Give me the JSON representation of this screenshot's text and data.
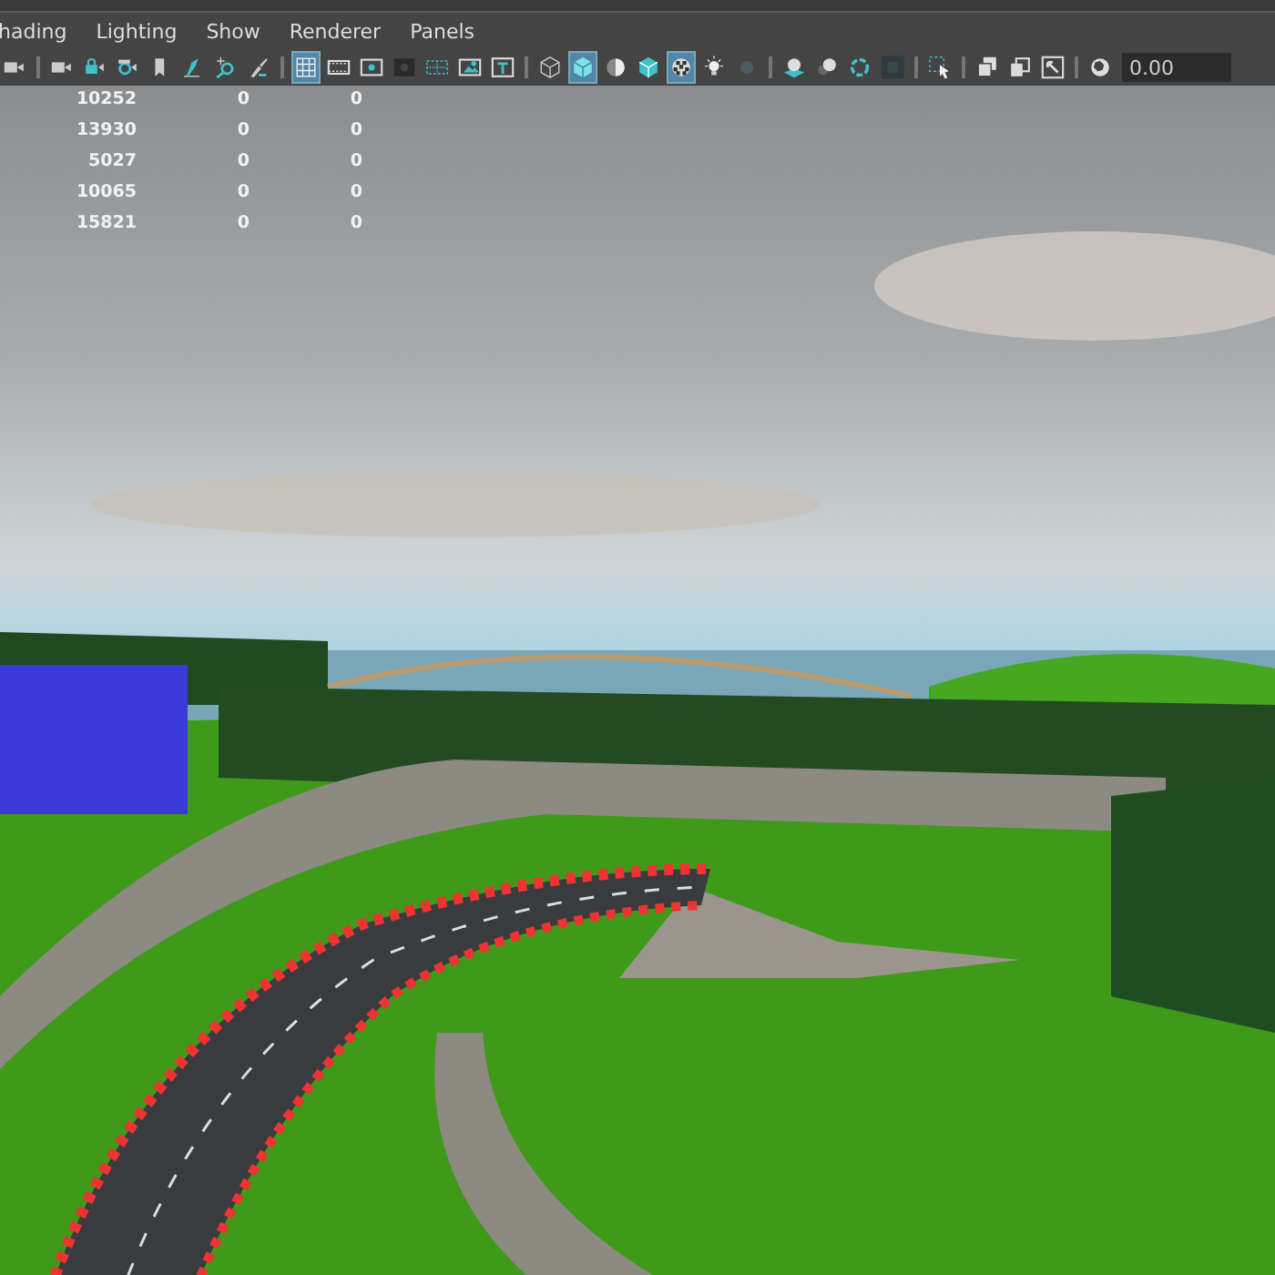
{
  "menu_bar": {
    "items": [
      "hading",
      "Lighting",
      "Show",
      "Renderer",
      "Panels"
    ]
  },
  "toolbar": {
    "groups": [
      {
        "buttons": [
          {
            "selected": false
          }
        ]
      },
      {
        "buttons": [
          {
            "selected": false
          },
          {
            "selected": false
          },
          {
            "selected": false
          },
          {
            "selected": false
          },
          {
            "selected": false
          },
          {
            "selected": false
          },
          {
            "selected": false
          }
        ]
      },
      {
        "buttons": [
          {
            "selected": true
          },
          {
            "selected": false
          },
          {
            "selected": false
          },
          {
            "selected": false
          },
          {
            "selected": false
          },
          {
            "selected": false
          },
          {
            "selected": false
          }
        ]
      },
      {
        "buttons": [
          {
            "selected": false
          },
          {
            "selected": true
          },
          {
            "selected": false
          },
          {
            "selected": false
          },
          {
            "selected": true
          },
          {
            "selected": false
          },
          {
            "selected": false
          }
        ]
      },
      {
        "buttons": [
          {
            "selected": false
          },
          {
            "selected": false
          },
          {
            "selected": false
          },
          {
            "selected": false
          }
        ]
      },
      {
        "buttons": [
          {
            "selected": false
          }
        ]
      },
      {
        "buttons": [
          {
            "selected": false
          },
          {
            "selected": false
          },
          {
            "selected": false
          }
        ]
      },
      {
        "buttons": [
          {
            "selected": false
          }
        ]
      }
    ],
    "time_field": {
      "value": "0.00"
    }
  },
  "viewport": {
    "stats_rows": [
      [
        "10252",
        "0",
        "0"
      ],
      [
        "13930",
        "0",
        "0"
      ],
      [
        "5027",
        "0",
        "0"
      ],
      [
        "10065",
        "0",
        "0"
      ],
      [
        "15821",
        "0",
        "0"
      ]
    ]
  }
}
